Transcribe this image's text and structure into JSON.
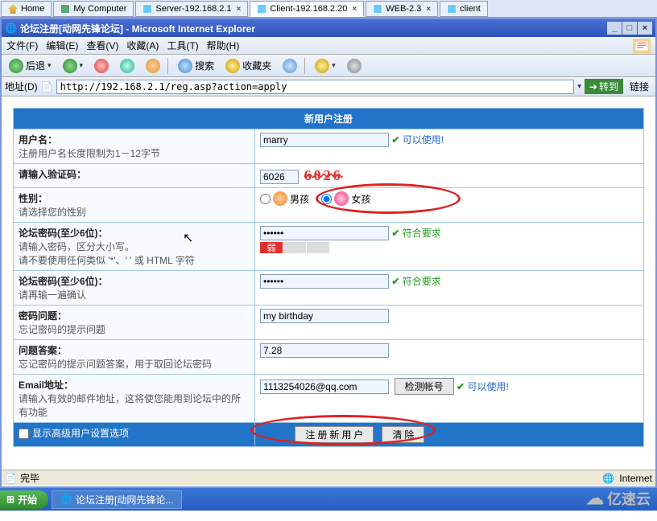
{
  "topTabs": {
    "home": "Home",
    "myComputer": "My Computer",
    "server": "Server-192.168.2.1",
    "client": "Client-192.168.2.20",
    "web": "WEB-2.3",
    "clientSmall": "client"
  },
  "ie": {
    "title": "论坛注册[动网先锋论坛] - Microsoft Internet Explorer",
    "menu": {
      "file": "文件(F)",
      "edit": "编辑(E)",
      "view": "查看(V)",
      "fav": "收藏(A)",
      "tools": "工具(T)",
      "help": "帮助(H)"
    },
    "toolbar": {
      "back": "后退",
      "search": "搜索",
      "fav": "收藏夹"
    },
    "addrLabel": "地址(D)",
    "url": "http://192.168.2.1/reg.asp?action=apply",
    "go": "转到",
    "links": "链接",
    "statusDone": "完毕",
    "zone": "Internet"
  },
  "form": {
    "header": "新用户注册",
    "username": {
      "label": "用户名：",
      "help": "注册用户名长度限制为1－12字节",
      "value": "marry",
      "ok": "可以使用!"
    },
    "captcha": {
      "label": "请输入验证码：",
      "value": "6026",
      "image": "6026"
    },
    "gender": {
      "label": "性别：",
      "help": "请选择您的性别",
      "boy": "男孩",
      "girl": "女孩",
      "selected": "girl"
    },
    "pw": {
      "label": "论坛密码(至少6位)：",
      "help1": "请输入密码，区分大小写。",
      "help2": "请不要使用任何类似 '*'、' ' 或 HTML 字符",
      "value": "••••••",
      "meter_weak": "弱",
      "ok": "符合要求"
    },
    "pw2": {
      "label": "论坛密码(至少6位)：",
      "help": "请再输一遍确认",
      "value": "••••••",
      "ok": "符合要求"
    },
    "question": {
      "label": "密码问题：",
      "help": "忘记密码的提示问题",
      "value": "my birthday"
    },
    "answer": {
      "label": "问题答案：",
      "help": "忘记密码的提示问题答案，用于取回论坛密码",
      "value": "7.28"
    },
    "email": {
      "label": "Email地址：",
      "help": "请输入有效的邮件地址，这将使您能用到论坛中的所有功能",
      "value": "1113254026@qq.com",
      "checkBtn": "检测帐号",
      "ok": "可以使用!"
    },
    "advanced": "显示高级用户设置选项",
    "submit": "注 册 新 用 户",
    "clear": "清 除"
  },
  "taskbar": {
    "start": "开始",
    "task": "论坛注册[动网先锋论..."
  },
  "watermark": "亿速云"
}
